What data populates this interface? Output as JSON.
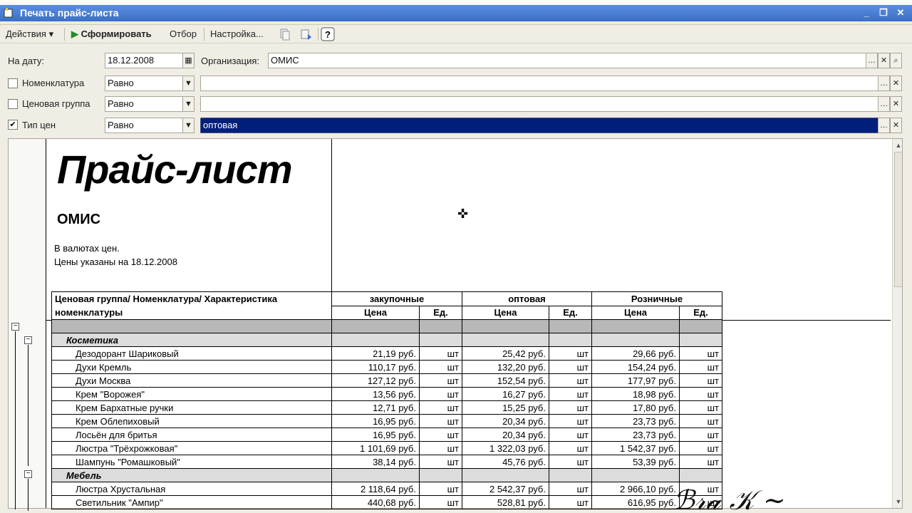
{
  "window": {
    "title": "Печать прайс-листа"
  },
  "toolbar": {
    "actions_label": "Действия",
    "generate_label": "Сформировать",
    "filter_label": "Отбор",
    "settings_label": "Настройка..."
  },
  "form": {
    "date_label": "На дату:",
    "date_value": "18.12.2008",
    "org_label": "Организация:",
    "org_value": "ОМИС",
    "nomenclature_label": "Номенклатура",
    "nomenclature_cond": "Равно",
    "nomenclature_checked": false,
    "price_group_label": "Ценовая группа",
    "price_group_cond": "Равно",
    "price_group_checked": false,
    "price_type_label": "Тип цен",
    "price_type_cond": "Равно",
    "price_type_checked": true,
    "price_type_value": "оптовая"
  },
  "report": {
    "title": "Прайс-лист",
    "organization": "ОМИС",
    "currency_note": "В валютах цен.",
    "date_note": "Цены указаны на 18.12.2008",
    "header": {
      "col_name": "Ценовая группа/ Номенклатура/ Характеристика номенклатуры",
      "groups": [
        "закупочные",
        "оптовая",
        "Розничные"
      ],
      "price": "Цена",
      "unit": "Ед."
    },
    "groups": [
      {
        "name": "Косметика",
        "items": [
          {
            "name": "Дезодорант Шариковый",
            "p1": "21,19 руб.",
            "u1": "шт",
            "p2": "25,42 руб.",
            "u2": "шт",
            "p3": "29,66 руб.",
            "u3": "шт"
          },
          {
            "name": "Духи Кремль",
            "p1": "110,17 руб.",
            "u1": "шт",
            "p2": "132,20 руб.",
            "u2": "шт",
            "p3": "154,24 руб.",
            "u3": "шт"
          },
          {
            "name": "Духи Москва",
            "p1": "127,12 руб.",
            "u1": "шт",
            "p2": "152,54 руб.",
            "u2": "шт",
            "p3": "177,97 руб.",
            "u3": "шт"
          },
          {
            "name": "Крем \"Ворожея\"",
            "p1": "13,56 руб.",
            "u1": "шт",
            "p2": "16,27 руб.",
            "u2": "шт",
            "p3": "18,98 руб.",
            "u3": "шт"
          },
          {
            "name": "Крем Бархатные ручки",
            "p1": "12,71 руб.",
            "u1": "шт",
            "p2": "15,25 руб.",
            "u2": "шт",
            "p3": "17,80 руб.",
            "u3": "шт"
          },
          {
            "name": "Крем Облепиховый",
            "p1": "16,95 руб.",
            "u1": "шт",
            "p2": "20,34 руб.",
            "u2": "шт",
            "p3": "23,73 руб.",
            "u3": "шт"
          },
          {
            "name": "Лосьён для бритья",
            "p1": "16,95 руб.",
            "u1": "шт",
            "p2": "20,34 руб.",
            "u2": "шт",
            "p3": "23,73 руб.",
            "u3": "шт"
          },
          {
            "name": "Люстра \"Трёхрожковая\"",
            "p1": "1 101,69 руб.",
            "u1": "шт",
            "p2": "1 322,03 руб.",
            "u2": "шт",
            "p3": "1 542,37 руб.",
            "u3": "шт"
          },
          {
            "name": "Шампунь \"Ромашковый\"",
            "p1": "38,14 руб.",
            "u1": "шт",
            "p2": "45,76 руб.",
            "u2": "шт",
            "p3": "53,39 руб.",
            "u3": "шт"
          }
        ]
      },
      {
        "name": "Мебель",
        "items": [
          {
            "name": "Люстра Хрустальная",
            "p1": "2 118,64 руб.",
            "u1": "шт",
            "p2": "2 542,37 руб.",
            "u2": "шт",
            "p3": "2 966,10 руб.",
            "u3": "шт"
          },
          {
            "name": "Светильник \"Ампир\"",
            "p1": "440,68 руб.",
            "u1": "шт",
            "p2": "528,81 руб.",
            "u2": "шт",
            "p3": "616,95 руб.",
            "u3": "шт"
          }
        ]
      }
    ]
  },
  "colors": {
    "titlebar": "#3b6fc6",
    "selection": "#001f7a",
    "gray_row": "#b8b8b8",
    "group_row": "#dcdcdc"
  }
}
